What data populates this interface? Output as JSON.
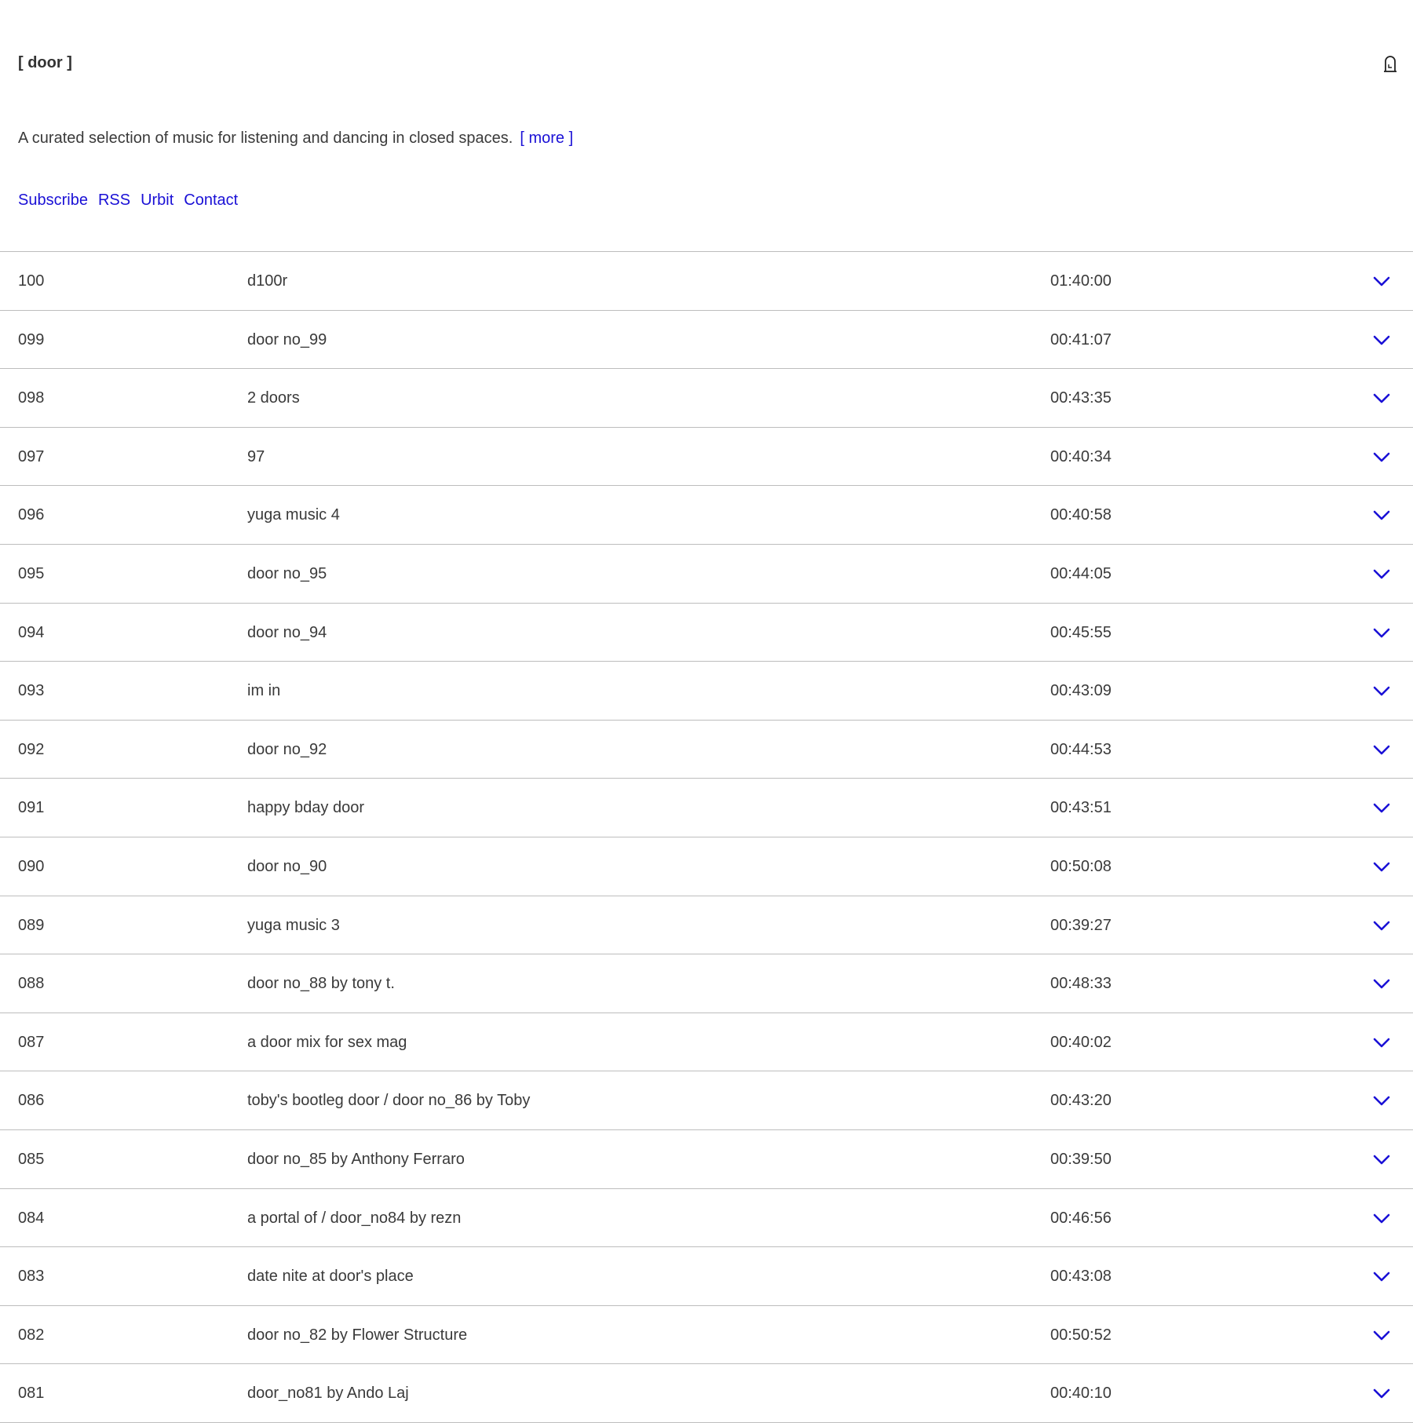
{
  "header": {
    "logo": "[ door ]",
    "icon": "door-keyhole-icon"
  },
  "intro": {
    "text": "A curated selection of music for listening and dancing in closed spaces.",
    "more_label": "[ more ]"
  },
  "nav": {
    "subscribe": "Subscribe",
    "rss": "RSS",
    "urbit": "Urbit",
    "contact": "Contact"
  },
  "colors": {
    "link": "#1a10d6",
    "text": "#3a3a3a",
    "divider": "#bdbdbd"
  },
  "mixes": [
    {
      "number": "100",
      "title": "d100r",
      "duration": "01:40:00"
    },
    {
      "number": "099",
      "title": "door no_99",
      "duration": "00:41:07"
    },
    {
      "number": "098",
      "title": "2 doors",
      "duration": "00:43:35"
    },
    {
      "number": "097",
      "title": "97",
      "duration": "00:40:34"
    },
    {
      "number": "096",
      "title": "yuga music 4",
      "duration": "00:40:58"
    },
    {
      "number": "095",
      "title": "door no_95",
      "duration": "00:44:05"
    },
    {
      "number": "094",
      "title": "door no_94",
      "duration": "00:45:55"
    },
    {
      "number": "093",
      "title": "im in",
      "duration": "00:43:09"
    },
    {
      "number": "092",
      "title": "door no_92",
      "duration": "00:44:53"
    },
    {
      "number": "091",
      "title": "happy bday door",
      "duration": "00:43:51"
    },
    {
      "number": "090",
      "title": "door no_90",
      "duration": "00:50:08"
    },
    {
      "number": "089",
      "title": "yuga music 3",
      "duration": "00:39:27"
    },
    {
      "number": "088",
      "title": "door no_88 by tony t.",
      "duration": "00:48:33"
    },
    {
      "number": "087",
      "title": "a door mix for sex mag",
      "duration": "00:40:02"
    },
    {
      "number": "086",
      "title": "toby's bootleg door / door no_86 by Toby",
      "duration": "00:43:20"
    },
    {
      "number": "085",
      "title": "door no_85 by Anthony Ferraro",
      "duration": "00:39:50"
    },
    {
      "number": "084",
      "title": "a portal of / door_no84 by rezn",
      "duration": "00:46:56"
    },
    {
      "number": "083",
      "title": "date nite at door's place",
      "duration": "00:43:08"
    },
    {
      "number": "082",
      "title": "door no_82 by Flower Structure",
      "duration": "00:50:52"
    },
    {
      "number": "081",
      "title": "door_no81 by Ando Laj",
      "duration": "00:40:10"
    }
  ]
}
